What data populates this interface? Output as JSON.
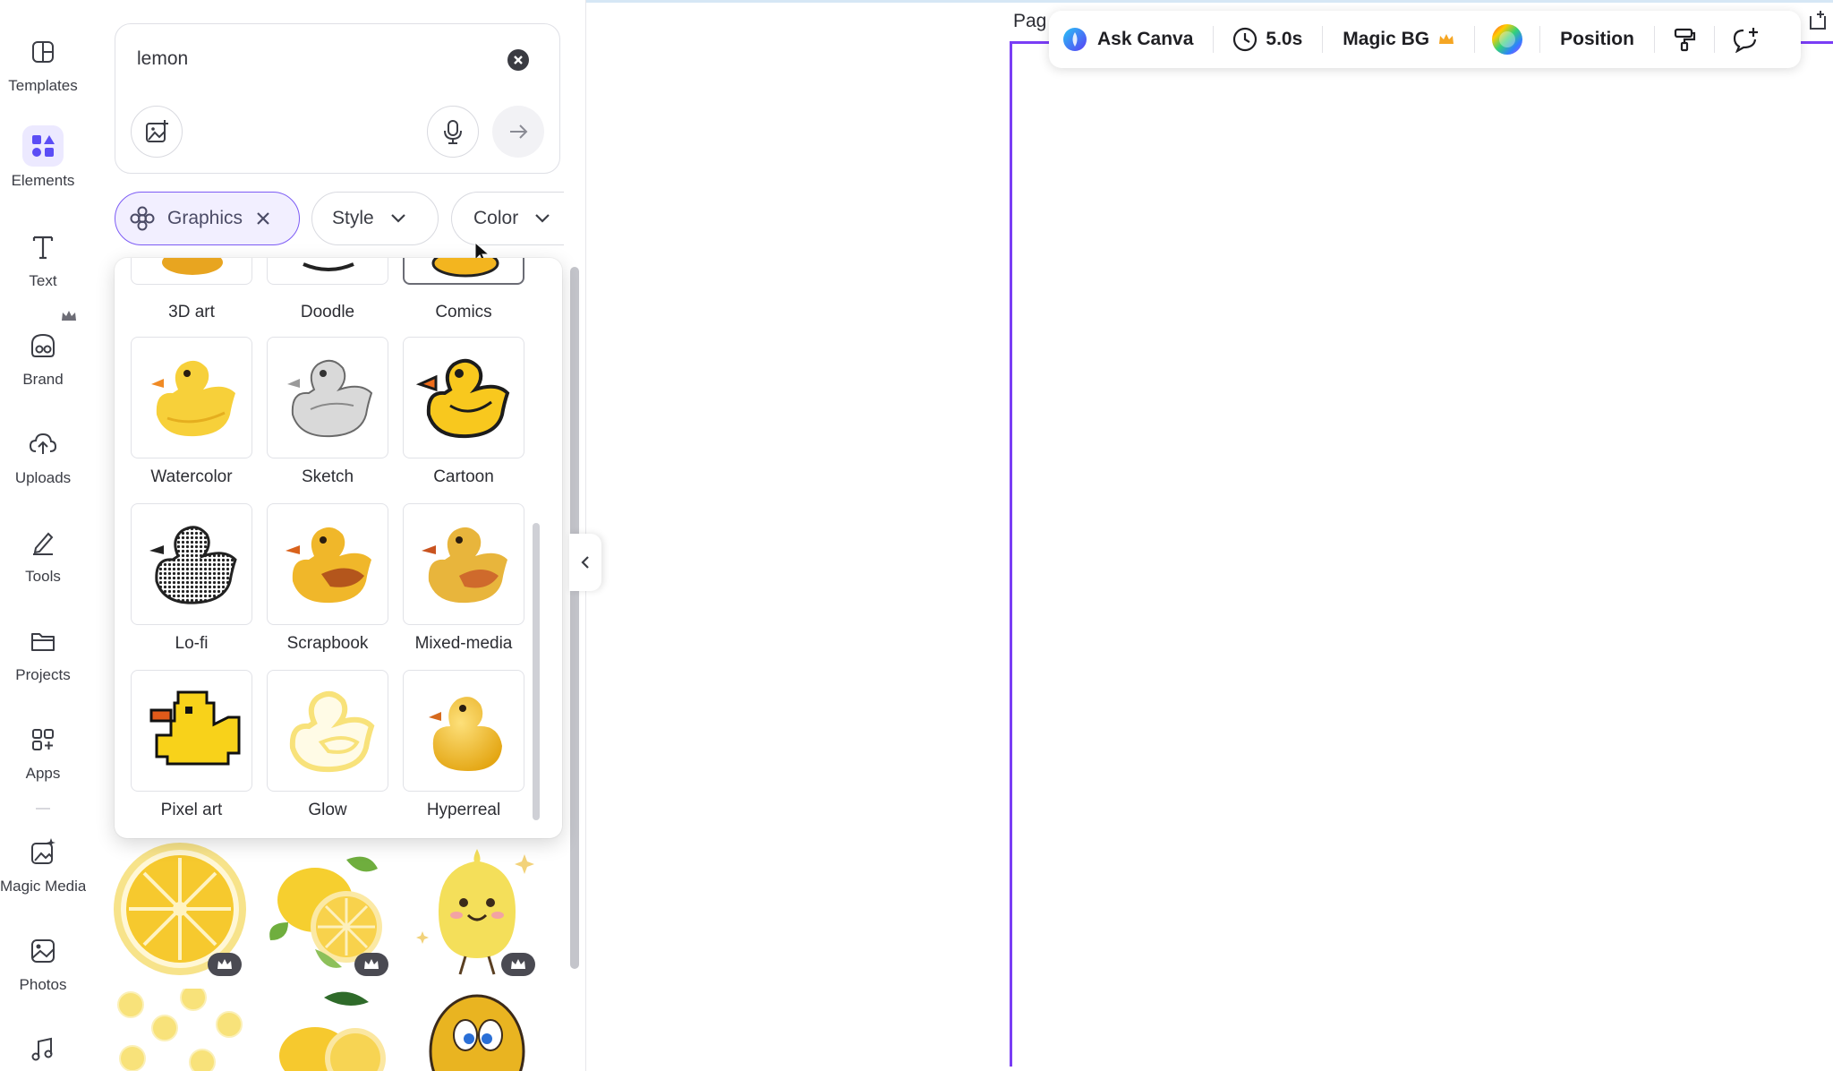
{
  "rail": {
    "items": [
      {
        "label": "Templates"
      },
      {
        "label": "Elements"
      },
      {
        "label": "Text"
      },
      {
        "label": "Brand"
      },
      {
        "label": "Uploads"
      },
      {
        "label": "Tools"
      },
      {
        "label": "Projects"
      },
      {
        "label": "Apps"
      },
      {
        "label": "Magic Media"
      },
      {
        "label": "Photos"
      }
    ]
  },
  "search": {
    "value": "lemon"
  },
  "filters": {
    "graphics_label": "Graphics",
    "style_label": "Style",
    "color_label": "Color"
  },
  "styles": [
    {
      "label": "3D art"
    },
    {
      "label": "Doodle"
    },
    {
      "label": "Comics"
    },
    {
      "label": "Watercolor"
    },
    {
      "label": "Sketch"
    },
    {
      "label": "Cartoon"
    },
    {
      "label": "Lo-fi"
    },
    {
      "label": "Scrapbook"
    },
    {
      "label": "Mixed-media"
    },
    {
      "label": "Pixel art"
    },
    {
      "label": "Glow"
    },
    {
      "label": "Hyperreal"
    }
  ],
  "canvas": {
    "page_label": "Pag"
  },
  "toolbar": {
    "ask_canva": "Ask Canva",
    "duration": "5.0s",
    "magic_bg": "Magic BG",
    "position": "Position"
  },
  "colors": {
    "accent": "#7a3df5",
    "active_chip_bg": "#f2efff",
    "duck_yellow": "#f7c62f",
    "lemon_yellow": "#f6d84a"
  }
}
